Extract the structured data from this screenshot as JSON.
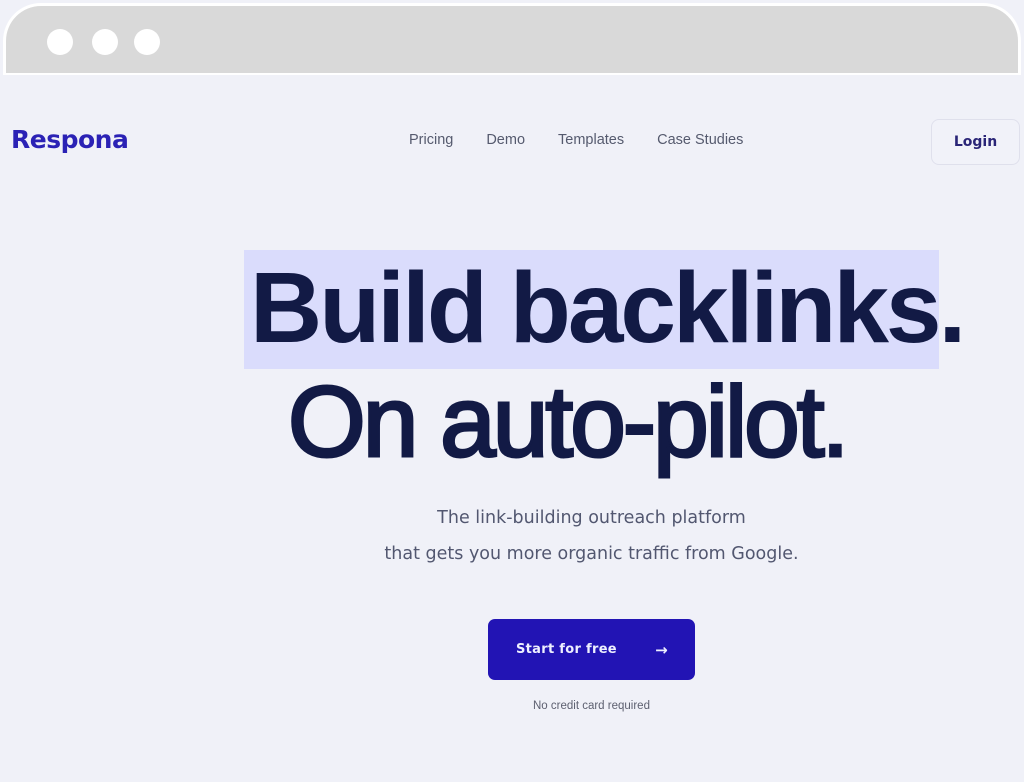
{
  "window": {
    "controls": [
      "window-dot",
      "window-dot",
      "window-dot"
    ]
  },
  "header": {
    "logo": "Respona",
    "nav": [
      {
        "label": "Pricing"
      },
      {
        "label": "Demo"
      },
      {
        "label": "Templates"
      },
      {
        "label": "Case Studies"
      }
    ],
    "login_label": "Login"
  },
  "hero": {
    "headline_line1": "Build backlinks.",
    "headline_line2": "On auto-pilot.",
    "subtitle_line1": "The link-building outreach platform",
    "subtitle_line2": "that gets you more organic traffic from Google.",
    "cta_label": "Start for free",
    "cta_icon": "arrow-right-icon",
    "cta_arrow": "→",
    "note": "No credit card required"
  },
  "colors": {
    "brand": "#2b22b5",
    "cta_background": "#2214b4",
    "headline": "#121a45",
    "highlight": "#dadcfc",
    "page_background": "#f0f1f8"
  }
}
